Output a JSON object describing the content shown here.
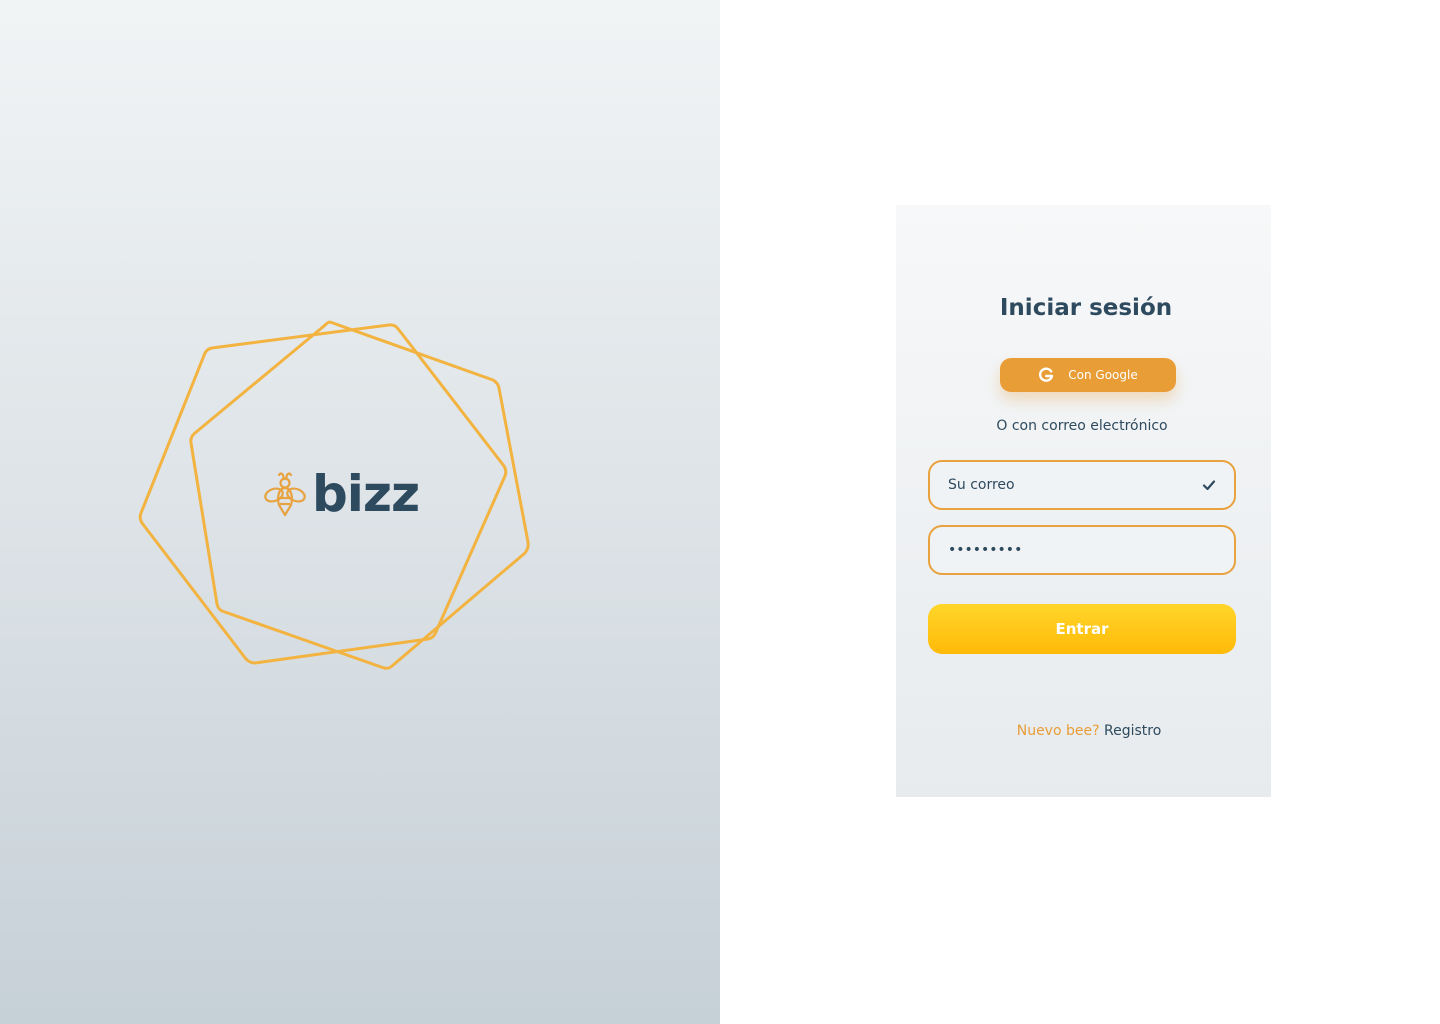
{
  "brand": {
    "logo_text": "bizz",
    "accent_color": "#f3b340",
    "primary_color": "#2e4a5e"
  },
  "login": {
    "title": "Iniciar sesión",
    "google_button_label": "Con Google",
    "divider_text": "O con correo electrónico",
    "email_placeholder": "Su correo",
    "password_value": "123456789",
    "submit_label": "Entrar",
    "register_prompt": "Nuevo bee?",
    "register_link": "Registro"
  },
  "icons": {
    "logo": "bee-icon",
    "google": "google-icon",
    "email_valid": "check-icon"
  }
}
